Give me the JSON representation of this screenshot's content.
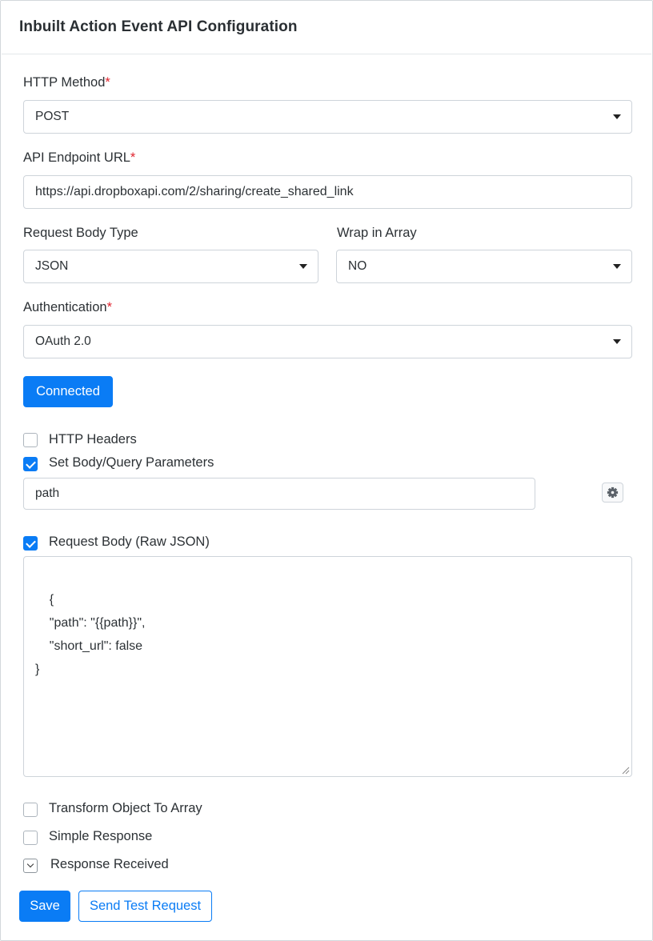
{
  "header": {
    "title": "Inbuilt Action Event API Configuration"
  },
  "http_method": {
    "label": "HTTP Method",
    "required_mark": "*",
    "value": "POST"
  },
  "endpoint": {
    "label": "API Endpoint URL",
    "required_mark": "*",
    "value": "https://api.dropboxapi.com/2/sharing/create_shared_link"
  },
  "body_type": {
    "label": "Request Body Type",
    "value": "JSON"
  },
  "wrap_array": {
    "label": "Wrap in Array",
    "value": "NO"
  },
  "auth": {
    "label": "Authentication",
    "required_mark": "*",
    "value": "OAuth 2.0"
  },
  "connected_button": "Connected",
  "options": {
    "http_headers": {
      "label": "HTTP Headers",
      "checked": false
    },
    "set_body_params": {
      "label": "Set Body/Query Parameters",
      "checked": true
    },
    "param_value": "path",
    "request_body_raw": {
      "label": "Request Body (Raw JSON)",
      "checked": true
    },
    "transform_object": {
      "label": "Transform Object To Array",
      "checked": false
    },
    "simple_response": {
      "label": "Simple Response",
      "checked": false
    },
    "response_received": {
      "label": "Response Received"
    }
  },
  "request_body": "{\n\t\"path\": \"{{path}}\",\n\t\"short_url\": false\n}",
  "actions": {
    "save": "Save",
    "send_test": "Send Test Request"
  },
  "icons": {
    "param_settings": "gear-icon",
    "dropdown": "caret-down-icon"
  },
  "colors": {
    "primary": "#0a7cf5",
    "required": "#e0242f"
  }
}
